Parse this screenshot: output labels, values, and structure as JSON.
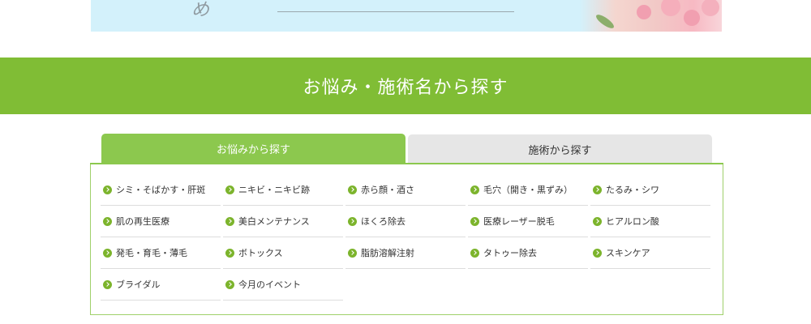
{
  "banner": {
    "script_char": "め"
  },
  "section": {
    "title": "お悩み・施術名から探す"
  },
  "tabs": [
    {
      "label": "お悩みから探す",
      "active": true
    },
    {
      "label": "施術から探す",
      "active": false
    }
  ],
  "concerns": [
    "シミ・そばかす・肝斑",
    "ニキビ・ニキビ跡",
    "赤ら顔・酒さ",
    "毛穴（開き・黒ずみ）",
    "たるみ・シワ",
    "肌の再生医療",
    "美白メンテナンス",
    "ほくろ除去",
    "医療レーザー脱毛",
    "ヒアルロン酸",
    "発毛・育毛・薄毛",
    "ボトックス",
    "脂肪溶解注射",
    "タトゥー除去",
    "スキンケア",
    "ブライダル",
    "今月のイベント"
  ],
  "colors": {
    "brand_green": "#80bd35",
    "tab_active": "#8cc84e",
    "tab_inactive": "#e6e6e6",
    "bullet": "#7cb42c"
  },
  "icons": {
    "bullet": "chevron-right-circle-icon"
  }
}
